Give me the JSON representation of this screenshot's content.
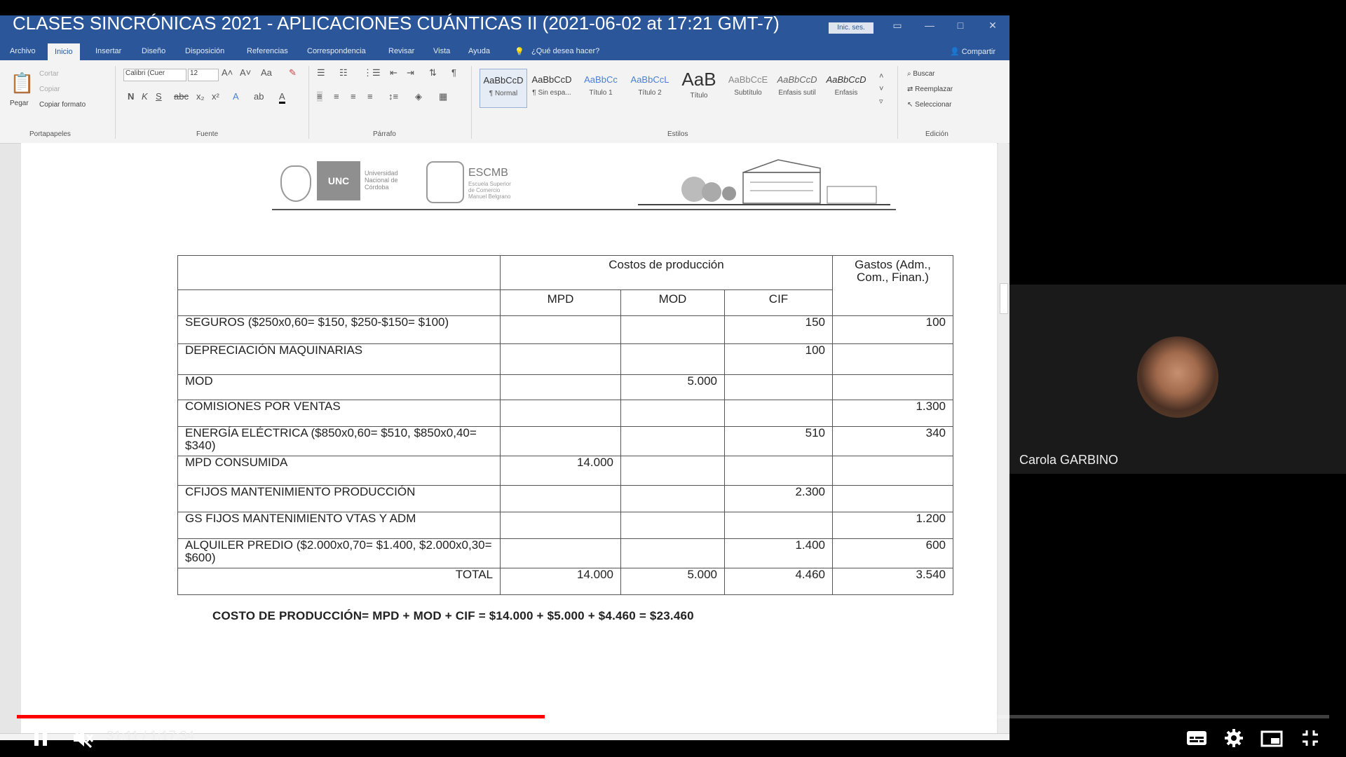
{
  "video": {
    "title": "CLASES SINCRÓNICAS 2021 - APLICACIONES CUÁNTICAS II (2021-06-02 at 17:21 GMT-7)",
    "progress_fraction": 0.402,
    "time_current": "31:11",
    "time_total": "1:17:34",
    "time_display": "31:11 / 1:17:34"
  },
  "word": {
    "signin_label": "Inic. ses.",
    "tabs": [
      "Archivo",
      "Inicio",
      "Insertar",
      "Diseño",
      "Disposición",
      "Referencias",
      "Correspondencia",
      "Revisar",
      "Vista",
      "Ayuda",
      "¿Qué desea hacer?"
    ],
    "active_tab": "Inicio",
    "share_label": "Compartir",
    "ribbon": {
      "clipboard": {
        "paste": "Pegar",
        "cut": "Cortar",
        "copy": "Copiar",
        "format_painter": "Copiar formato",
        "group": "Portapapeles"
      },
      "font": {
        "name": "Calibri (Cuer",
        "size": "12",
        "group": "Fuente"
      },
      "paragraph": {
        "group": "Párrafo"
      },
      "styles": {
        "group": "Estilos",
        "items": [
          {
            "sample": "AaBbCcD",
            "name": "¶ Normal"
          },
          {
            "sample": "AaBbCcD",
            "name": "¶ Sin espa..."
          },
          {
            "sample": "AaBbCc",
            "name": "Título 1"
          },
          {
            "sample": "AaBbCcL",
            "name": "Título 2"
          },
          {
            "sample": "AaB",
            "name": "Título"
          },
          {
            "sample": "AaBbCcE",
            "name": "Subtítulo"
          },
          {
            "sample": "AaBbCcD",
            "name": "Énfasis sutil"
          },
          {
            "sample": "AaBbCcD",
            "name": "Énfasis"
          }
        ]
      },
      "editing": {
        "find": "Buscar",
        "replace": "Reemplazar",
        "select": "Seleccionar",
        "group": "Edición"
      }
    },
    "header": {
      "unc": "UNC",
      "unc_sub": "Universidad Nacional de Córdoba",
      "escmb": "ESCMB",
      "escmb_sub": "Escuela Superior de Comercio Manuel Belgrano"
    },
    "table": {
      "group_header": "Costos de producción",
      "expenses_header": "Gastos (Adm., Com., Finan.)",
      "col_headers": [
        "MPD",
        "MOD",
        "CIF"
      ],
      "rows": [
        {
          "concept": "SEGUROS ($250x0,60= $150, $250-$150= $100)",
          "mpd": "",
          "mod": "",
          "cif": "150",
          "gastos": "100"
        },
        {
          "concept": "DEPRECIACIÓN MAQUINARIAS",
          "mpd": "",
          "mod": "",
          "cif": "100",
          "gastos": ""
        },
        {
          "concept": "MOD",
          "mpd": "",
          "mod": "5.000",
          "cif": "",
          "gastos": ""
        },
        {
          "concept": "COMISIONES POR VENTAS",
          "mpd": "",
          "mod": "",
          "cif": "",
          "gastos": "1.300"
        },
        {
          "concept": "ENERGÍA ELÉCTRICA ($850x0,60= $510, $850x0,40= $340)",
          "mpd": "",
          "mod": "",
          "cif": "510",
          "gastos": "340"
        },
        {
          "concept": "MPD CONSUMIDA",
          "mpd": "14.000",
          "mod": "",
          "cif": "",
          "gastos": ""
        },
        {
          "concept": "CFIJOS MANTENIMIENTO PRODUCCIÓN",
          "mpd": "",
          "mod": "",
          "cif": "2.300",
          "gastos": ""
        },
        {
          "concept": "GS FIJOS MANTENIMIENTO VTAS Y ADM",
          "mpd": "",
          "mod": "",
          "cif": "",
          "gastos": "1.200"
        },
        {
          "concept": "ALQUILER PREDIO ($2.000x0,70= $1.400, $2.000x0,30= $600)",
          "mpd": "",
          "mod": "",
          "cif": "1.400",
          "gastos": "600"
        }
      ],
      "total": {
        "label": "TOTAL",
        "mpd": "14.000",
        "mod": "5.000",
        "cif": "4.460",
        "gastos": "3.540"
      }
    },
    "formula": "COSTO DE PRODUCCIÓN= MPD + MOD + CIF = $14.000 + $5.000 + $4.460 = $23.460"
  },
  "participant": {
    "name": "Carola GARBINO"
  },
  "colors": {
    "word_blue": "#2b579a",
    "progress_red": "#ff0000"
  }
}
